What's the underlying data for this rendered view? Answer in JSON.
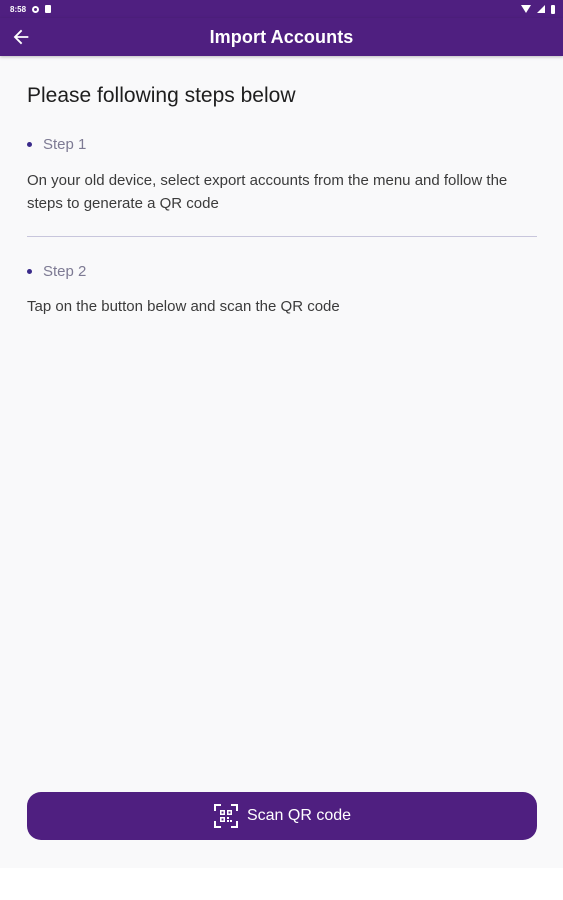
{
  "status_bar": {
    "time": "8:58",
    "icons": [
      "gear-icon",
      "sd-card-icon",
      "wifi-icon",
      "signal-icon",
      "battery-icon"
    ]
  },
  "app_bar": {
    "title": "Import Accounts",
    "back_icon": "arrow-left-icon"
  },
  "main": {
    "heading": "Please following steps below",
    "steps": [
      {
        "label": "Step 1",
        "text": "On your old device, select export accounts from the menu and follow the steps to generate a QR code"
      },
      {
        "label": "Step 2",
        "text": "Tap on the button below and scan the QR code"
      }
    ]
  },
  "scan_button": {
    "label": "Scan QR code",
    "icon": "qr-scan-icon"
  },
  "colors": {
    "primary": "#4f1f80",
    "bullet": "#3a2a8a",
    "step_label": "#7d7a93",
    "background": "#f9f9fa"
  }
}
